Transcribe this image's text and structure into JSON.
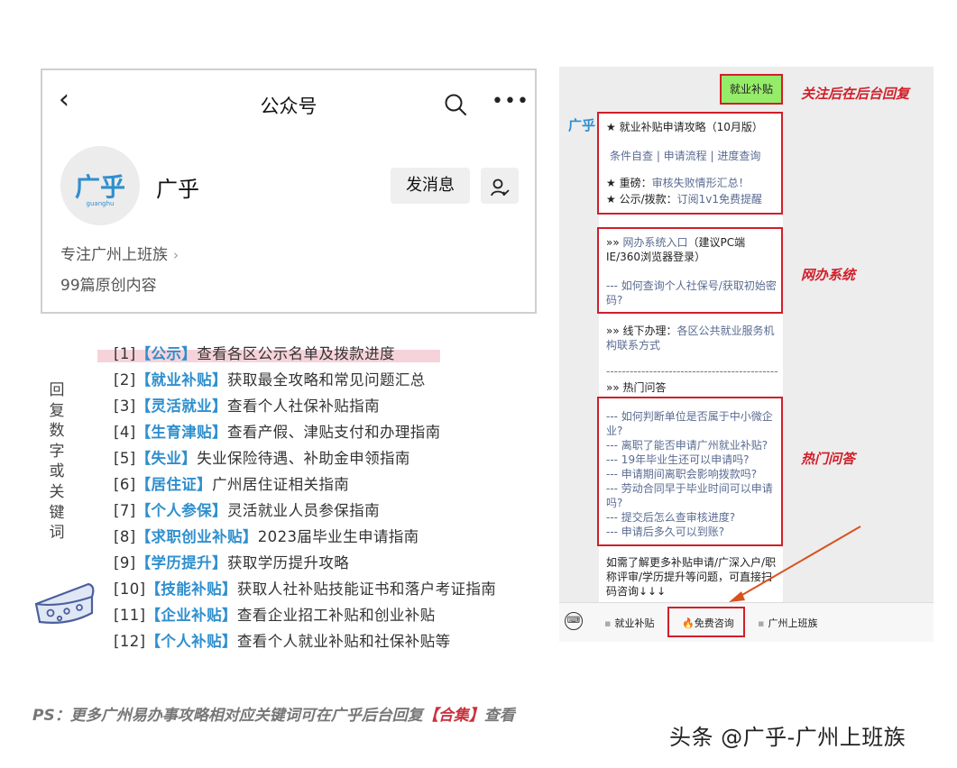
{
  "profile": {
    "back_icon": "chevron-left-icon",
    "title": "公众号",
    "name": "广乎",
    "logo_text": "广乎",
    "logo_sub": "guanghu",
    "send_message": "发消息",
    "description": "专注广州上班族",
    "article_count": "99篇原创内容"
  },
  "side_label": "回复数字或关键词",
  "keyword_list": [
    {
      "num": "[1]",
      "kw": "【公示】",
      "text": "查看各区公示名单及拨款进度"
    },
    {
      "num": "[2]",
      "kw": "【就业补贴】",
      "text": "获取最全攻略和常见问题汇总"
    },
    {
      "num": "[3]",
      "kw": "【灵活就业】",
      "text": "查看个人社保补贴指南"
    },
    {
      "num": "[4]",
      "kw": "【生育津贴】",
      "text": "查看产假、津贴支付和办理指南"
    },
    {
      "num": "[5]",
      "kw": "【失业】",
      "text": "失业保险待遇、补助金申领指南"
    },
    {
      "num": "[6]",
      "kw": "【居住证】",
      "text": "广州居住证相关指南"
    },
    {
      "num": "[7]",
      "kw": "【个人参保】",
      "text": "灵活就业人员参保指南"
    },
    {
      "num": "[8]",
      "kw": "【求职创业补贴】",
      "text": "2023届毕业生申请指南"
    },
    {
      "num": "[9]",
      "kw": "【学历提升】",
      "text": "获取学历提升攻略"
    },
    {
      "num": "[10]",
      "kw": "【技能补贴】",
      "text": "获取人社补贴技能证书和落户考证指南"
    },
    {
      "num": "[11]",
      "kw": "【企业补贴】",
      "text": "查看企业招工补贴和创业补贴"
    },
    {
      "num": "[12]",
      "kw": "【个人补贴】",
      "text": "查看个人就业补贴和社保补贴等"
    }
  ],
  "ps": {
    "prefix": "PS：更多广州易办事攻略相对应关键词可在广乎后台回复",
    "highlight": "【合集】",
    "suffix": "查看"
  },
  "chat": {
    "user_message": "就业补贴",
    "annotations": {
      "reply": "关注后在后台回复",
      "system": "网办系统",
      "faq": "热门问答"
    },
    "bot_avatar": "广乎",
    "block1": {
      "title": "★ 就业补贴申请攻略（10月版）",
      "links": "条件自查 | 申请流程 | 进度查询",
      "important_label": "★ 重磅：",
      "important_link": "审核失败情形汇总！",
      "public_label": "★ 公示/拨款：",
      "public_link": "订阅1v1免费提醒"
    },
    "block2": {
      "entry_prefix": "»» ",
      "entry_link": "网办系统入口",
      "entry_suffix": "（建议PC端IE/360浏览器登录）",
      "query": "--- 如何查询个人社保号/获取初始密码?"
    },
    "offline": {
      "prefix": "»» 线下办理：",
      "link": "各区公共就业服务机构联系方式"
    },
    "divider": "------------------------------------------------",
    "faq_title": "»» 热门问答",
    "faq": [
      "--- 如何判断单位是否属于中小微企业?",
      "--- 离职了能否申请广州就业补贴?",
      "--- 19年毕业生还可以申请吗?",
      "--- 申请期间离职会影响拨款吗?",
      "--- 劳动合同早于毕业时间可以申请吗?",
      "--- 提交后怎么查审核进度?",
      "--- 申请后多久可以到账?"
    ],
    "footer_text": "如需了解更多补贴申请/广深入户/职称评审/学历提升等问题，可直接扫码咨询↓↓↓",
    "menu": [
      "就业补贴",
      "🔥免费咨询",
      "广州上班族"
    ]
  },
  "watermark": "头条 @广乎-广州上班族",
  "colors": {
    "accent_blue": "#2f8fce",
    "annotation_red": "#d11f2a",
    "user_bubble": "#95ec69",
    "highlight_pink": "#f6d3da"
  }
}
